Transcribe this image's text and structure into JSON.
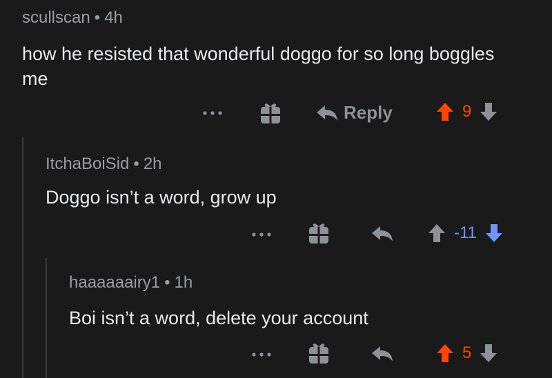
{
  "comments": [
    {
      "author": "scullscan",
      "separator": "•",
      "time": "4h",
      "body": "how he resisted that wonderful doggo for so long boggles me",
      "reply_label": "Reply",
      "score": "9",
      "vote_state": "upvoted"
    },
    {
      "author": "ItchaBoiSid",
      "separator": "•",
      "time": "2h",
      "body": "Doggo isn’t a word, grow up",
      "score": "-11",
      "vote_state": "downvoted"
    },
    {
      "author": "haaaaaairy1",
      "separator": "•",
      "time": "1h",
      "body": "Boi isn’t a word, delete your account",
      "score": "5",
      "vote_state": "upvoted"
    }
  ],
  "colors": {
    "background": "#1a1a1b",
    "upvote": "#ff4500",
    "downvote": "#7193ff",
    "neutral_icon": "#8e9296"
  }
}
